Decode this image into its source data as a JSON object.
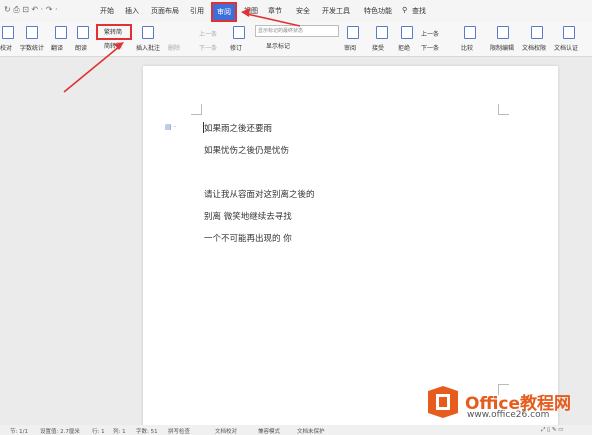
{
  "menubar": {
    "tabs": [
      "开始",
      "插入",
      "页面布局",
      "引用",
      "审阅",
      "视图",
      "章节",
      "安全",
      "开发工具",
      "特色功能",
      "查找"
    ],
    "active_tab": "审阅"
  },
  "ribbon": {
    "items": [
      "校对",
      "字数统计",
      "翻译",
      "朗读",
      "繁转简",
      "简转繁",
      "插入批注",
      "删除",
      "上一条",
      "下一条",
      "修订",
      "显示标记的最终状态",
      "显示标记",
      "审阅",
      "接受",
      "拒绝",
      "上一条",
      "下一条",
      "比较",
      "限制编辑",
      "文档权限",
      "文档认证"
    ]
  },
  "document": {
    "lines": [
      "如果雨之後还要雨",
      "如果忧伤之後仍是忧伤",
      "",
      "请让我从容面对这别离之後的",
      "别离  微笑地继续去寻找",
      "一个不可能再出现的 你"
    ]
  },
  "statusbar": {
    "items": [
      "节: 1/1",
      "设置值: 2.7厘米",
      "行: 1",
      "列: 1",
      "字数: 51",
      "拼写检查",
      "文档校对",
      "兼容模式",
      "文档未保护"
    ]
  },
  "watermark": {
    "brand": "Office教程网",
    "url": "www.office26.com"
  },
  "colors": {
    "accent": "#3e6ed8",
    "highlight": "#e03232",
    "logo": "#e65c1e"
  }
}
